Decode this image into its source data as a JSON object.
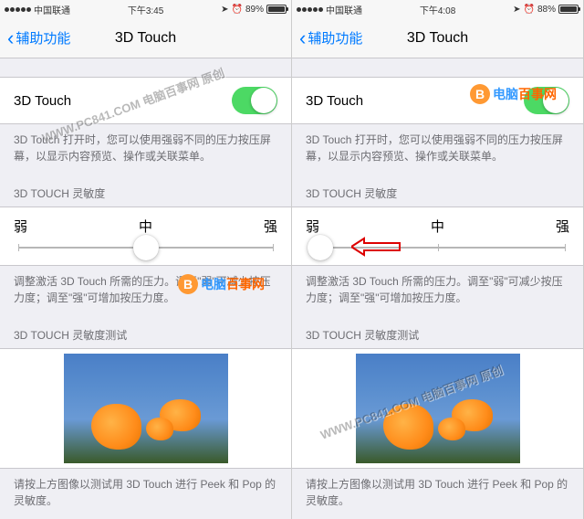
{
  "screens": [
    {
      "status": {
        "carrier": "中国联通",
        "time": "下午3:45",
        "battery_pct": "89%",
        "battery_fill_pct": 89
      },
      "nav": {
        "back_label": "辅助功能",
        "title": "3D Touch"
      },
      "toggle_cell": {
        "label": "3D Touch",
        "on": true
      },
      "toggle_desc": "3D Touch 打开时，您可以使用强弱不同的压力按压屏幕，以显示内容预览、操作或关联菜单。",
      "sensitivity_header": "3D TOUCH 灵敏度",
      "slider": {
        "weak": "弱",
        "mid": "中",
        "strong": "强",
        "thumb_pct": 50
      },
      "sensitivity_desc": "调整激活 3D Touch 所需的压力。调至\"弱\"可减少按压力度；调至\"强\"可增加按压力度。",
      "test_header": "3D TOUCH 灵敏度测试",
      "test_desc": "请按上方图像以测试用 3D Touch 进行 Peek 和 Pop 的灵敏度。",
      "has_arrow": false,
      "watermark_diag": "WWW.PC841.COM 电脑百事网 原创",
      "watermark_logo": {
        "brand1": "电脑",
        "brand2": "百事网"
      }
    },
    {
      "status": {
        "carrier": "中国联通",
        "time": "下午4:08",
        "battery_pct": "88%",
        "battery_fill_pct": 88
      },
      "nav": {
        "back_label": "辅助功能",
        "title": "3D Touch"
      },
      "toggle_cell": {
        "label": "3D Touch",
        "on": true
      },
      "toggle_desc": "3D Touch 打开时，您可以使用强弱不同的压力按压屏幕，以显示内容预览、操作或关联菜单。",
      "sensitivity_header": "3D TOUCH 灵敏度",
      "slider": {
        "weak": "弱",
        "mid": "中",
        "strong": "强",
        "thumb_pct": 4
      },
      "sensitivity_desc": "调整激活 3D Touch 所需的压力。调至\"弱\"可减少按压力度；调至\"强\"可增加按压力度。",
      "test_header": "3D TOUCH 灵敏度测试",
      "test_desc": "请按上方图像以测试用 3D Touch 进行 Peek 和 Pop 的灵敏度。",
      "has_arrow": true,
      "watermark_diag": "WWW.PC841.COM 电脑百事网 原创",
      "watermark_logo": {
        "brand1": "电脑",
        "brand2": "百事网"
      }
    }
  ]
}
